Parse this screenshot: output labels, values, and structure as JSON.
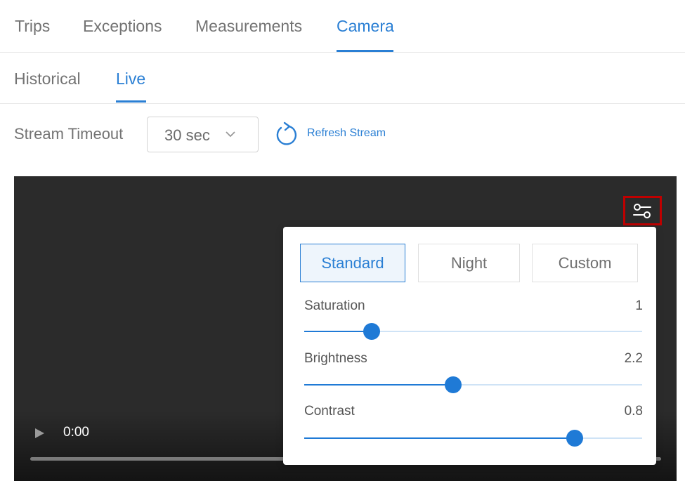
{
  "top_tabs": [
    {
      "label": "Trips",
      "active": false
    },
    {
      "label": "Exceptions",
      "active": false
    },
    {
      "label": "Measurements",
      "active": false
    },
    {
      "label": "Camera",
      "active": true
    }
  ],
  "sub_tabs": [
    {
      "label": "Historical",
      "active": false
    },
    {
      "label": "Live",
      "active": true
    }
  ],
  "controls": {
    "stream_timeout_label": "Stream Timeout",
    "stream_timeout_value": "30 sec",
    "refresh_label": "Refresh Stream"
  },
  "player": {
    "time": "0:00",
    "progress": 0
  },
  "panel": {
    "modes": [
      {
        "label": "Standard",
        "active": true
      },
      {
        "label": "Night",
        "active": false
      },
      {
        "label": "Custom",
        "active": false
      }
    ],
    "sliders": [
      {
        "label": "Saturation",
        "value": "1",
        "level": 0.2
      },
      {
        "label": "Brightness",
        "value": "2.2",
        "level": 0.44
      },
      {
        "label": "Contrast",
        "value": "0.8",
        "level": 0.8
      }
    ]
  },
  "icons": {
    "settings": "sliders-settings-icon",
    "refresh": "refresh-icon",
    "dropdown": "chevron-down-icon",
    "play": "play-icon"
  },
  "colors": {
    "accent": "#2a7fd4",
    "highlight_box": "#c00000",
    "video_bg": "#2b2b2b"
  }
}
